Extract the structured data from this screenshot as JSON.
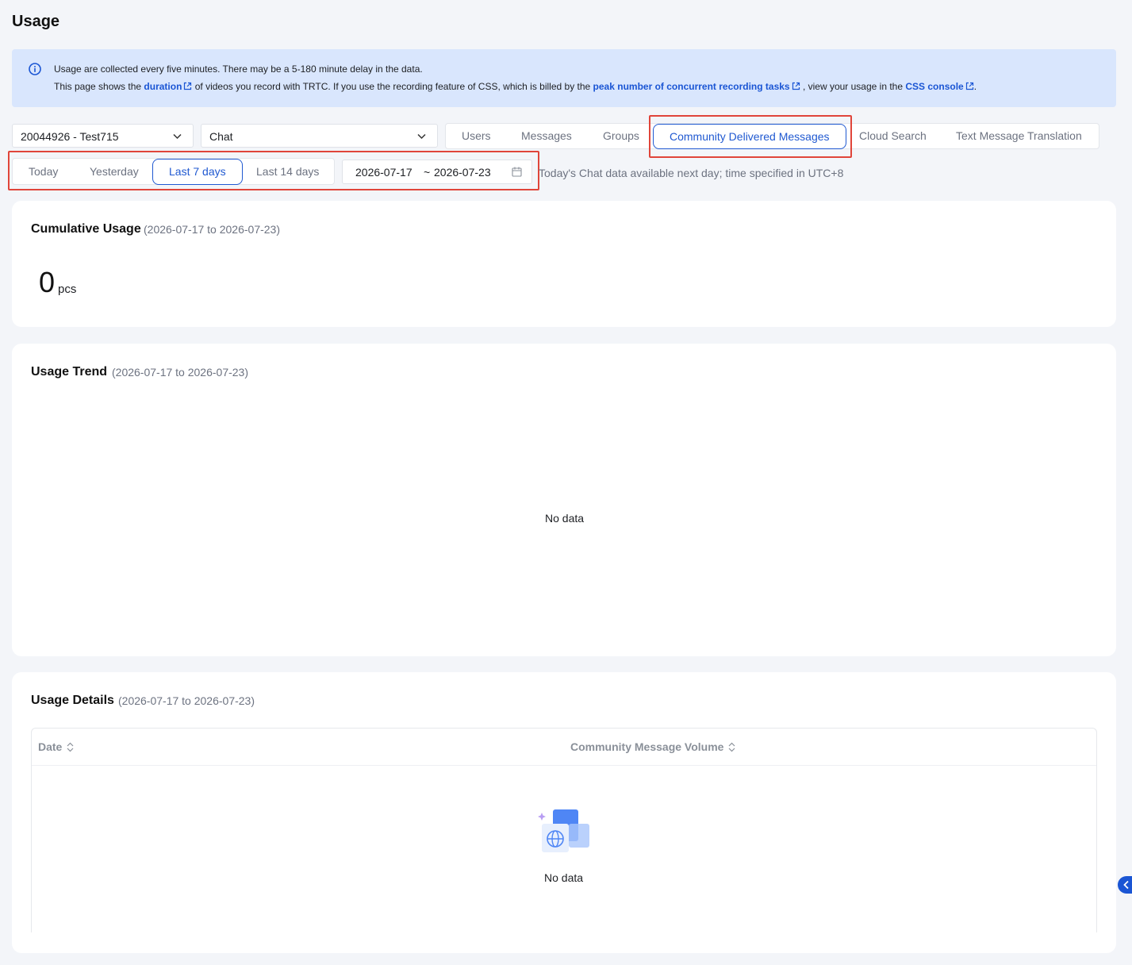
{
  "page": {
    "title": "Usage"
  },
  "notice": {
    "line1": "Usage are collected every five minutes. There may be a 5-180 minute delay in the data.",
    "line2_part1": "This page shows the ",
    "link_duration": "duration",
    "line2_part2": " of videos you record with TRTC. If you use the recording feature of CSS, which is billed by the ",
    "link_peak": "peak number of concurrent recording tasks",
    "line2_part3": " , view your usage in the ",
    "link_console": "CSS console",
    "line2_part4": "."
  },
  "filters": {
    "app_select": "20044926 - Test715",
    "product_select": "Chat"
  },
  "product_tabs": [
    {
      "label": "Users"
    },
    {
      "label": "Messages"
    },
    {
      "label": "Groups"
    },
    {
      "label": "Community Delivered Messages",
      "active": true
    },
    {
      "label": "Cloud Search"
    },
    {
      "label": "Text Message Translation"
    }
  ],
  "range_buttons": [
    {
      "label": "Today"
    },
    {
      "label": "Yesterday"
    },
    {
      "label": "Last 7 days",
      "active": true
    },
    {
      "label": "Last 14 days"
    }
  ],
  "date_picker": {
    "start": "2026-07-17",
    "separator": "~",
    "end": "2026-07-23"
  },
  "hint": "Today's Chat data available next day; time specified in UTC+8",
  "cumulative": {
    "title": "Cumulative Usage",
    "range": "(2026-07-17 to 2026-07-23)",
    "value": "0",
    "unit": "pcs"
  },
  "trend": {
    "title": "Usage Trend",
    "range": "(2026-07-17 to 2026-07-23)",
    "empty": "No data"
  },
  "details": {
    "title": "Usage Details",
    "range": "(2026-07-17 to 2026-07-23)",
    "columns": [
      "Date",
      "Community Message Volume"
    ],
    "empty": "No data"
  },
  "colors": {
    "accent": "#2059d1",
    "highlight": "#e0453a",
    "notice_bg": "#d9e6fd"
  }
}
